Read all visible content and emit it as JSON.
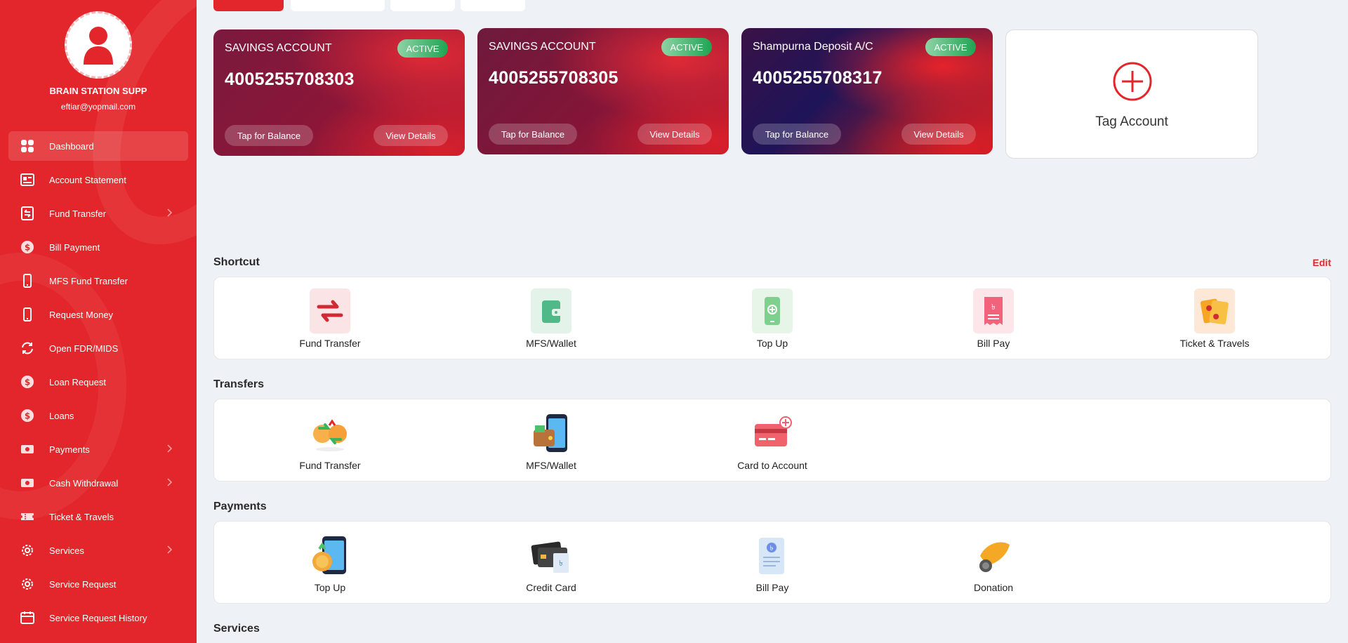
{
  "user": {
    "name": "BRAIN STATION SUPP",
    "email": "eftiar@yopmail.com"
  },
  "sidebar": {
    "items": [
      {
        "label": "Dashboard"
      },
      {
        "label": "Account Statement"
      },
      {
        "label": "Fund Transfer"
      },
      {
        "label": "Bill Payment"
      },
      {
        "label": "MFS Fund Transfer"
      },
      {
        "label": "Request Money"
      },
      {
        "label": "Open FDR/MIDS"
      },
      {
        "label": "Loan Request"
      },
      {
        "label": "Loans"
      },
      {
        "label": "Payments"
      },
      {
        "label": "Cash Withdrawal"
      },
      {
        "label": "Ticket & Travels"
      },
      {
        "label": "Services"
      },
      {
        "label": "Service Request"
      },
      {
        "label": "Service Request History"
      }
    ]
  },
  "accounts": [
    {
      "type": "SAVINGS ACCOUNT",
      "number": "4005255708303",
      "status": "ACTIVE",
      "balance_label": "Tap for Balance",
      "details_label": "View Details"
    },
    {
      "type": "SAVINGS ACCOUNT",
      "number": "4005255708305",
      "status": "ACTIVE",
      "balance_label": "Tap for Balance",
      "details_label": "View Details"
    },
    {
      "type": "Shampurna Deposit A/C",
      "number": "4005255708317",
      "status": "ACTIVE",
      "balance_label": "Tap for Balance",
      "details_label": "View Details"
    }
  ],
  "tag_account": {
    "label": "Tag Account"
  },
  "shortcut": {
    "title": "Shortcut",
    "edit_label": "Edit",
    "items": [
      {
        "label": "Fund Transfer"
      },
      {
        "label": "MFS/Wallet"
      },
      {
        "label": "Top Up"
      },
      {
        "label": "Bill Pay"
      },
      {
        "label": "Ticket & Travels"
      }
    ]
  },
  "transfers": {
    "title": "Transfers",
    "items": [
      {
        "label": "Fund Transfer"
      },
      {
        "label": "MFS/Wallet"
      },
      {
        "label": "Card to Account"
      }
    ]
  },
  "payments": {
    "title": "Payments",
    "items": [
      {
        "label": "Top Up"
      },
      {
        "label": "Credit Card"
      },
      {
        "label": "Bill Pay"
      },
      {
        "label": "Donation"
      }
    ]
  },
  "services": {
    "title": "Services"
  },
  "colors": {
    "brand_red": "#e3262b",
    "active_green": "#1fa453",
    "background": "#eef1f6"
  }
}
